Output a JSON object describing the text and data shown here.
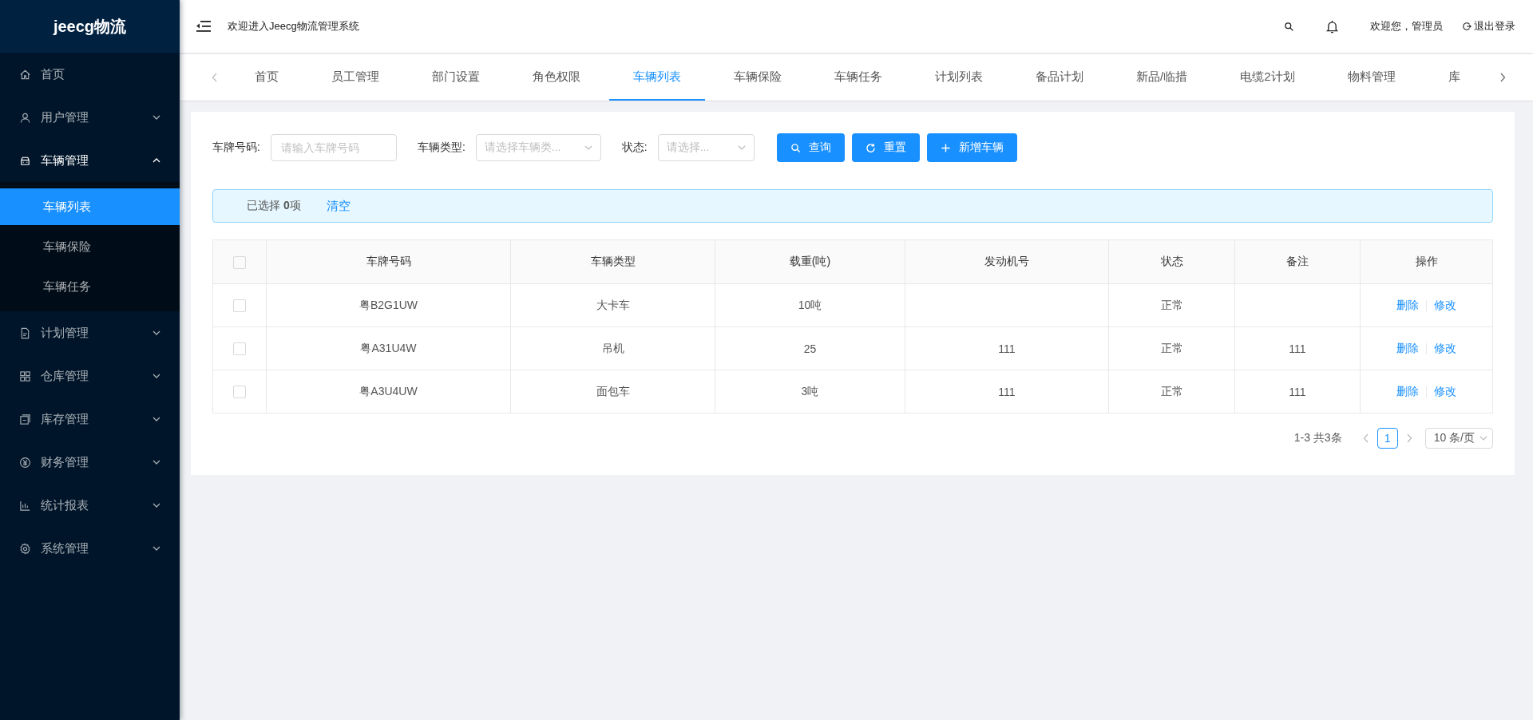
{
  "sidebar": {
    "logo": "jeecg物流",
    "items": [
      {
        "label": "首页"
      },
      {
        "label": "用户管理",
        "expanded": false
      },
      {
        "label": "车辆管理",
        "expanded": true,
        "children": [
          {
            "label": "车辆列表",
            "selected": true
          },
          {
            "label": "车辆保险",
            "selected": false
          },
          {
            "label": "车辆任务",
            "selected": false
          }
        ]
      },
      {
        "label": "计划管理",
        "expanded": false
      },
      {
        "label": "仓库管理",
        "expanded": false
      },
      {
        "label": "库存管理",
        "expanded": false
      },
      {
        "label": "财务管理",
        "expanded": false
      },
      {
        "label": "统计报表",
        "expanded": false
      },
      {
        "label": "系统管理",
        "expanded": false
      }
    ]
  },
  "header": {
    "title": "欢迎进入Jeecg物流管理系统",
    "user": "欢迎您，管理员",
    "logout": "退出登录"
  },
  "tabs": [
    {
      "label": "首页",
      "selected": false
    },
    {
      "label": "员工管理",
      "selected": false
    },
    {
      "label": "部门设置",
      "selected": false
    },
    {
      "label": "角色权限",
      "selected": false
    },
    {
      "label": "车辆列表",
      "selected": true
    },
    {
      "label": "车辆保险",
      "selected": false
    },
    {
      "label": "车辆任务",
      "selected": false
    },
    {
      "label": "计划列表",
      "selected": false
    },
    {
      "label": "备品计划",
      "selected": false
    },
    {
      "label": "新品/临措",
      "selected": false
    },
    {
      "label": "电缆2计划",
      "selected": false
    },
    {
      "label": "物料管理",
      "selected": false
    },
    {
      "label": "库",
      "selected": false
    }
  ],
  "filters": [
    {
      "kind": "input",
      "label": "车牌号码:",
      "placeholder": "请输入车牌号码"
    },
    {
      "kind": "select",
      "label": "车辆类型:",
      "placeholder": "请选择车辆类..."
    },
    {
      "kind": "select",
      "label": "状态:",
      "placeholder": "请选择..."
    }
  ],
  "buttons": [
    {
      "kind": "search",
      "label": "查询"
    },
    {
      "kind": "reset",
      "label": "重置"
    },
    {
      "kind": "add",
      "label": "新增车辆"
    }
  ],
  "selection": {
    "text": "已选择 **0**项",
    "clear": "清空"
  },
  "table": {
    "columns": [
      "车牌号码",
      "车辆类型",
      "载重(吨)",
      "发动机号",
      "状态",
      "备注",
      "操作"
    ],
    "all_checked": false,
    "rows": [
      {
        "checked": false,
        "plate": "粤B2G1UW",
        "type": "大卡车",
        "load": "10吨",
        "status": "正常",
        "actions": [
          "删除",
          "修改"
        ]
      },
      {
        "checked": false,
        "plate": "粤A31U4W",
        "type": "吊机",
        "load": "25",
        "engine": "111",
        "status": "正常",
        "note": "111",
        "actions": [
          "删除",
          "修改"
        ]
      },
      {
        "checked": false,
        "plate": "粤A3U4UW",
        "type": "面包车",
        "load": "3吨",
        "engine": "111",
        "status": "正常",
        "note": "111",
        "actions": [
          "删除",
          "修改"
        ]
      }
    ]
  },
  "pagination": {
    "total": "1-3 共3条",
    "pages": [
      {
        "label": "1",
        "selected": true
      }
    ],
    "page_size": "10 条/页"
  }
}
